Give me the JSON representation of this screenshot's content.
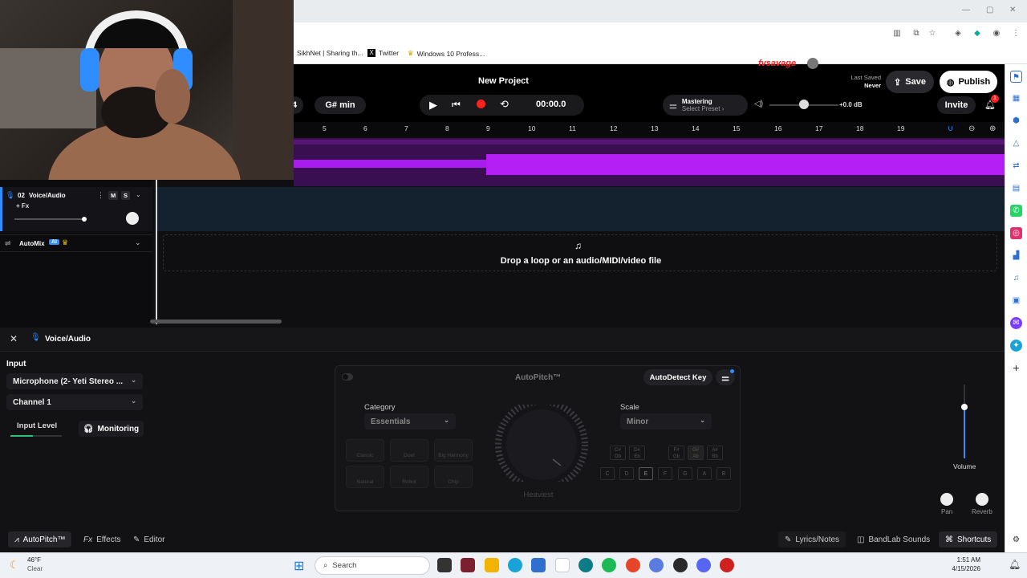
{
  "browser": {
    "bookmarks": [
      "SikhNet | Sharing th...",
      "Twitter",
      "Windows 10 Profess..."
    ],
    "window_controls": [
      "—",
      "▢",
      "✕"
    ]
  },
  "header": {
    "project_title": "New Project",
    "brand_name": "fvsavage",
    "last_saved_label": "Last Saved",
    "last_saved_value": "Never",
    "save_label": "Save",
    "publish_label": "Publish",
    "bpm_partial": "4",
    "key": "G# min",
    "time": "00:00.0",
    "mastering_label": "Mastering",
    "mastering_preset": "Select Preset ›",
    "volume_db": "+0.0 dB",
    "invite_label": "Invite",
    "notification_count": "1"
  },
  "ruler": {
    "ticks": [
      "5",
      "6",
      "7",
      "8",
      "9",
      "10",
      "11",
      "12",
      "13",
      "14",
      "15",
      "16",
      "17",
      "18",
      "19"
    ]
  },
  "tracks": [
    {
      "number": "02",
      "name": "Voice/Audio",
      "fx_label": "+ Fx",
      "mute": "M",
      "solo": "S"
    }
  ],
  "automix": {
    "label": "AutoMix",
    "badge": "AI"
  },
  "drop_zone": {
    "text": "Drop a loop or an audio/MIDI/video file"
  },
  "panel": {
    "track_name": "Voice/Audio",
    "input_heading": "Input",
    "input_device": "Microphone (2- Yeti Stereo ...",
    "channel": "Channel 1",
    "input_level_label": "Input Level",
    "monitoring_label": "Monitoring",
    "volume_label": "Volume",
    "pan_label": "Pan",
    "reverb_label": "Reverb"
  },
  "autopitch": {
    "title": "AutoPitch™",
    "autodetect_label": "AutoDetect Key",
    "category_label": "Category",
    "category_value": "Essentials",
    "scale_label": "Scale",
    "scale_value": "Minor",
    "knob_label": "Heaviest",
    "modes": [
      "Classic",
      "Duet",
      "Big Harmony",
      "Natural",
      "Robot",
      "Chip"
    ],
    "sharp_keys": [
      [
        "C#",
        "Db"
      ],
      [
        "D#",
        "Eb"
      ],
      [
        "F#",
        "Gb"
      ],
      [
        "G#",
        "Ab"
      ],
      [
        "A#",
        "Bb"
      ]
    ],
    "natural_keys": [
      "C",
      "D",
      "E",
      "F",
      "G",
      "A",
      "B"
    ],
    "active_key": "E"
  },
  "footer": {
    "autopitch_tab": "AutoPitch™",
    "effects_tab": "Effects",
    "editor_tab": "Editor",
    "lyrics_label": "Lyrics/Notes",
    "sounds_label": "BandLab Sounds",
    "shortcuts_label": "Shortcuts"
  },
  "taskbar": {
    "weather_temp": "46°F",
    "weather_desc": "Clear",
    "search_placeholder": "Search",
    "time": "1:51 AM",
    "date": "4/15/2026"
  },
  "colors": {
    "accent_blue": "#2f8dff",
    "waveform_purple": "#a81cf0",
    "record_red": "#ff2020"
  }
}
